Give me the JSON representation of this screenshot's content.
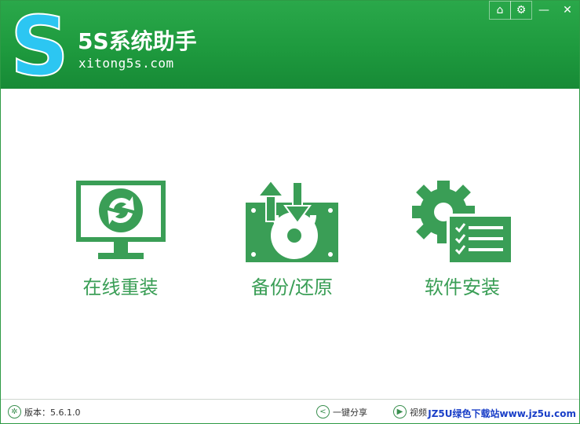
{
  "app": {
    "name": "5S系统助手",
    "url": "xitong5s.com",
    "logo_letter": "S"
  },
  "window_controls": {
    "home": "⌂",
    "settings": "⚙",
    "minimize": "—",
    "close": "✕"
  },
  "features": [
    {
      "label": "在线重装",
      "icon": "monitor-refresh-icon"
    },
    {
      "label": "备份/还原",
      "icon": "backup-restore-disk-icon"
    },
    {
      "label": "软件安装",
      "icon": "gear-checklist-icon"
    }
  ],
  "footer": {
    "version_label": "版本：5.6.1.0",
    "share_label": "一键分享",
    "video_label": "视频",
    "watermark": "JZ5U绿色下载站www.jz5u.com"
  },
  "colors": {
    "header_green": "#1e9a3e",
    "accent_green": "#3a9e56",
    "logo_blue": "#2cc6f2",
    "watermark_blue": "#1a3fc8"
  }
}
